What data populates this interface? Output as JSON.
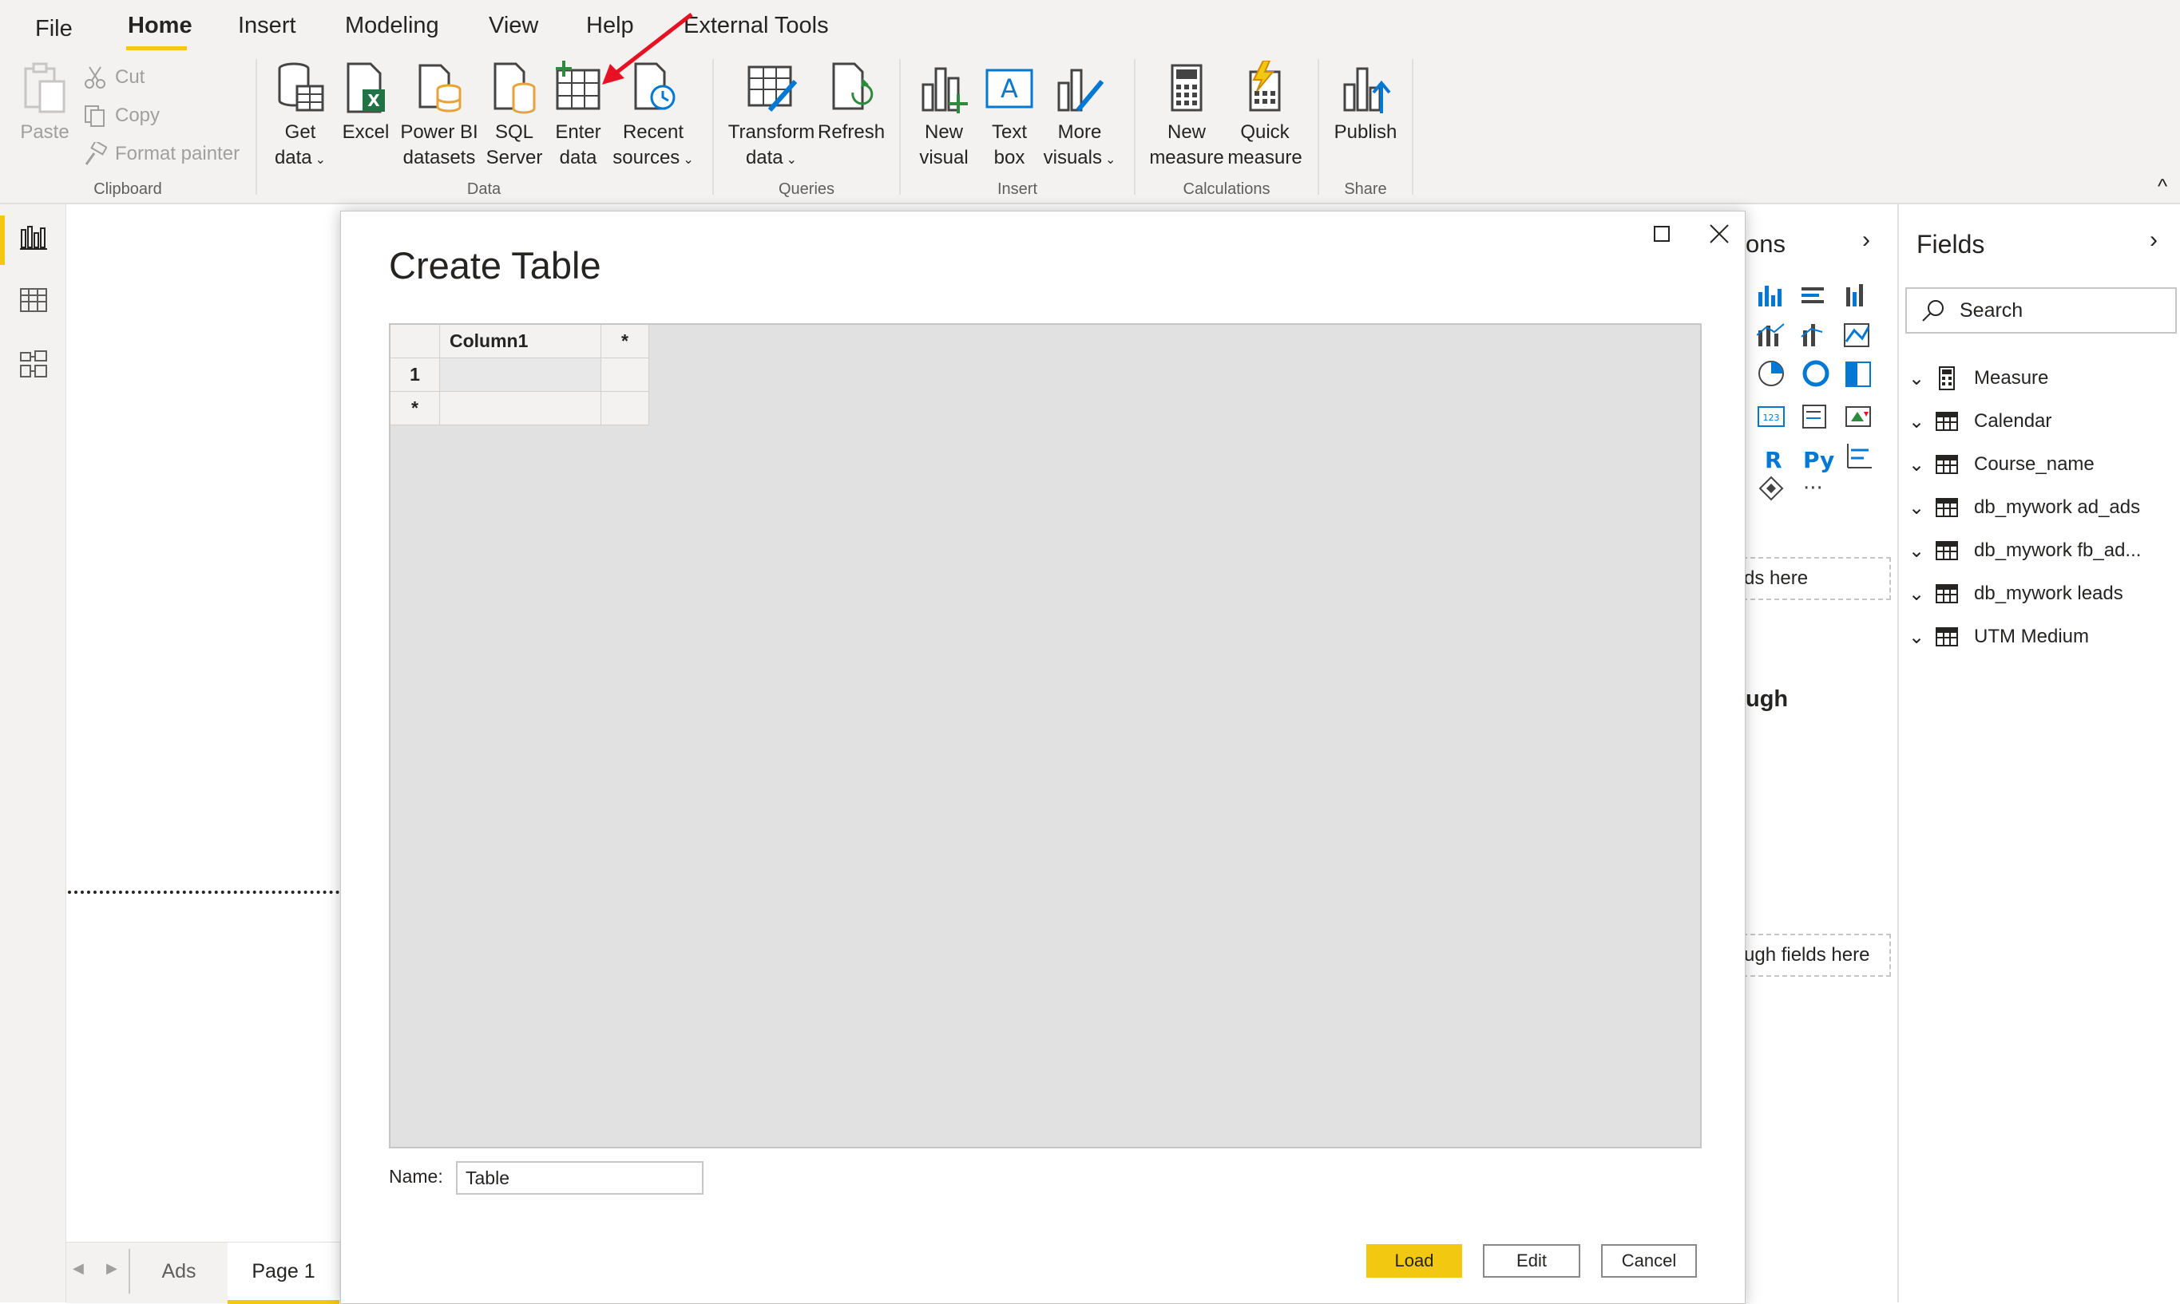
{
  "menu": {
    "tabs": [
      "File",
      "Home",
      "Insert",
      "Modeling",
      "View",
      "Help",
      "External Tools"
    ],
    "active": "Home"
  },
  "ribbon": {
    "clipboard": {
      "paste": "Paste",
      "cut": "Cut",
      "copy": "Copy",
      "format_painter": "Format painter",
      "group": "Clipboard"
    },
    "data": {
      "get_data": [
        "Get",
        "data"
      ],
      "excel": [
        "Excel"
      ],
      "powerbi": [
        "Power BI",
        "datasets"
      ],
      "sql": [
        "SQL",
        "Server"
      ],
      "enter": [
        "Enter",
        "data"
      ],
      "recent": [
        "Recent",
        "sources"
      ],
      "group": "Data"
    },
    "queries": {
      "transform": [
        "Transform",
        "data"
      ],
      "refresh": [
        "Refresh"
      ],
      "group": "Queries"
    },
    "insert": {
      "new_visual": [
        "New",
        "visual"
      ],
      "text_box": [
        "Text",
        "box"
      ],
      "more_visuals": [
        "More",
        "visuals"
      ],
      "group": "Insert"
    },
    "calculations": {
      "new_measure": [
        "New",
        "measure"
      ],
      "quick_measure": [
        "Quick",
        "measure"
      ],
      "group": "Calculations"
    },
    "share": {
      "publish": [
        "Publish"
      ],
      "group": "Share"
    },
    "collapse_glyph": "^"
  },
  "page_tabs": {
    "items": [
      "Ads",
      "Page 1"
    ],
    "active": "Page 1"
  },
  "visualizations_pane": {
    "title_fragment": "ons",
    "drop1": "ds here",
    "heading_fragment": "ugh",
    "drop2": "ugh fields here",
    "r_label": "R",
    "py_label": "Py",
    "more_glyph": "···"
  },
  "fields_pane": {
    "title": "Fields",
    "search_placeholder": "Search",
    "items": [
      "Measure",
      "Calendar",
      "Course_name",
      "db_mywork ad_ads",
      "db_mywork fb_ad...",
      "db_mywork leads",
      "UTM Medium"
    ]
  },
  "dialog": {
    "title": "Create Table",
    "grid": {
      "column_header": "Column1",
      "add_column": "*",
      "row_numbers": [
        "1",
        "*"
      ]
    },
    "name_label": "Name:",
    "name_value": "Table",
    "buttons": {
      "load": "Load",
      "edit": "Edit",
      "cancel": "Cancel"
    }
  },
  "colors": {
    "accent_yellow": "#f2c811",
    "arrow_red": "#e81123",
    "ribbon_bg": "#f3f2f1",
    "grid_bg": "#e1e1e1"
  }
}
